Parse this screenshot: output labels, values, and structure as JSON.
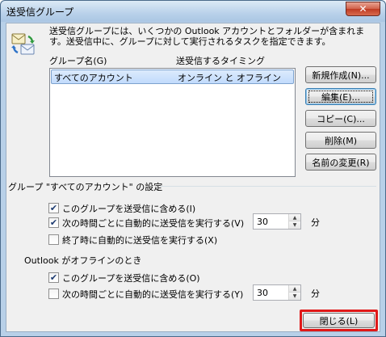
{
  "window": {
    "title": "送受信グループ",
    "close_glyph": "✕"
  },
  "description": "送受信グループには、いくつかの Outlook アカウントとフォルダーが含まれます。送受信中に、グループに対して実行されるタスクを指定できます。",
  "list": {
    "col_group_name": "グループ名(G)",
    "col_timing": "送受信するタイミング",
    "rows": [
      {
        "name": "すべてのアカウント",
        "timing": "オンライン と オフライン"
      }
    ]
  },
  "buttons": {
    "new": "新規作成(N)...",
    "edit": "編集(E)...",
    "copy": "コピー(C)...",
    "delete": "削除(M)",
    "rename": "名前の変更(R)",
    "close": "閉じる(L)"
  },
  "settings": {
    "group_title": "グループ \"すべてのアカウント\" の設定",
    "online": {
      "include_label": "このグループを送受信に含める(I)",
      "include_checked": true,
      "schedule_label": "次の時間ごとに自動的に送受信を実行する(V)",
      "schedule_checked": true,
      "minutes": "30",
      "unit": "分",
      "on_exit_label": "終了時に自動的に送受信を実行する(X)",
      "on_exit_checked": false
    },
    "offline_title": "Outlook がオフラインのとき",
    "offline": {
      "include_label": "このグループを送受信に含める(O)",
      "include_checked": true,
      "schedule_label": "次の時間ごとに自動的に送受信を実行する(Y)",
      "schedule_checked": false,
      "minutes": "30",
      "unit": "分"
    }
  },
  "check_glyph": "✔",
  "spin_up_glyph": "▲",
  "spin_down_glyph": "▼"
}
